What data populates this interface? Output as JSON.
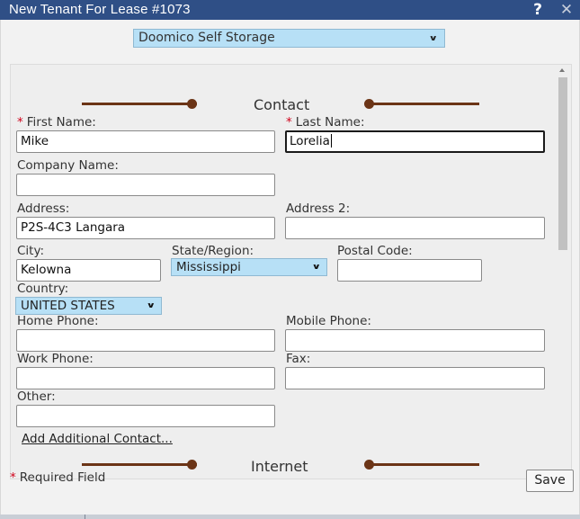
{
  "window": {
    "title": "New Tenant For Lease #1073",
    "help_icon": "?",
    "close_icon": "✕"
  },
  "facility": {
    "selected": "Doomico Self Storage"
  },
  "sections": {
    "contact": "Contact",
    "internet": "Internet"
  },
  "form": {
    "first_name": {
      "label": "First Name:",
      "value": "Mike",
      "required": true
    },
    "last_name": {
      "label": "Last Name:",
      "value": "Lorelia",
      "required": true
    },
    "company_name": {
      "label": "Company Name:",
      "value": ""
    },
    "address": {
      "label": "Address:",
      "value": "P2S-4C3 Langara"
    },
    "address2": {
      "label": "Address 2:",
      "value": ""
    },
    "city": {
      "label": "City:",
      "value": "Kelowna"
    },
    "state": {
      "label": "State/Region:",
      "value": "Mississippi"
    },
    "postal_code": {
      "label": "Postal Code:",
      "value": ""
    },
    "country": {
      "label": "Country:",
      "value": "UNITED STATES"
    },
    "home_phone": {
      "label": "Home Phone:",
      "value": ""
    },
    "mobile_phone": {
      "label": "Mobile Phone:",
      "value": ""
    },
    "work_phone": {
      "label": "Work Phone:",
      "value": ""
    },
    "fax": {
      "label": "Fax:",
      "value": ""
    },
    "other": {
      "label": "Other:",
      "value": ""
    }
  },
  "add_contact_link": "Add Additional Contact...",
  "required_marker": "*",
  "footer": {
    "required_note": "Required Field",
    "save_label": "Save"
  },
  "colors": {
    "titlebar": "#2f4f86",
    "select_bg": "#b7e0f6",
    "divider": "#6b3416",
    "required": "#d0021b"
  }
}
